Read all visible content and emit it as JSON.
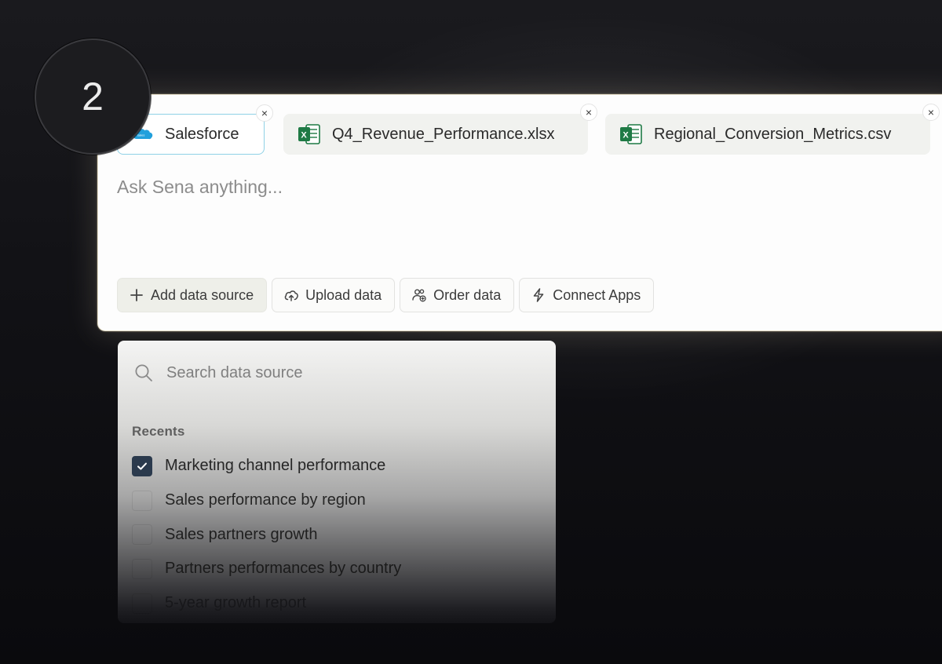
{
  "step": {
    "number": "2"
  },
  "composer": {
    "chips": [
      {
        "label": "Salesforce",
        "icon": "salesforce-icon",
        "selected": true
      },
      {
        "label": "Q4_Revenue_Performance.xlsx",
        "icon": "excel-icon"
      },
      {
        "label": "Regional_Conversion_Metrics.csv",
        "icon": "excel-icon"
      }
    ],
    "close_glyph": "×",
    "prompt_placeholder": "Ask Sena anything...",
    "actions": [
      {
        "label": "Add data source",
        "icon": "plus-icon"
      },
      {
        "label": "Upload data",
        "icon": "cloud-upload-icon"
      },
      {
        "label": "Order data",
        "icon": "users-icon"
      },
      {
        "label": "Connect Apps",
        "icon": "lightning-icon"
      }
    ]
  },
  "dropdown": {
    "search_placeholder": "Search data source",
    "section_label": "Recents",
    "items": [
      {
        "label": "Marketing channel performance",
        "checked": true
      },
      {
        "label": "Sales performance by region",
        "checked": false
      },
      {
        "label": "Sales partners growth",
        "checked": false
      },
      {
        "label": "Partners performances by country",
        "checked": false
      },
      {
        "label": "5-year growth report",
        "checked": false
      }
    ]
  },
  "colors": {
    "accent_selected_border": "#8fd1e6",
    "checkbox_checked": "#2b3a4d",
    "excel_green": "#1f7a45",
    "salesforce_blue": "#21a0dc"
  }
}
